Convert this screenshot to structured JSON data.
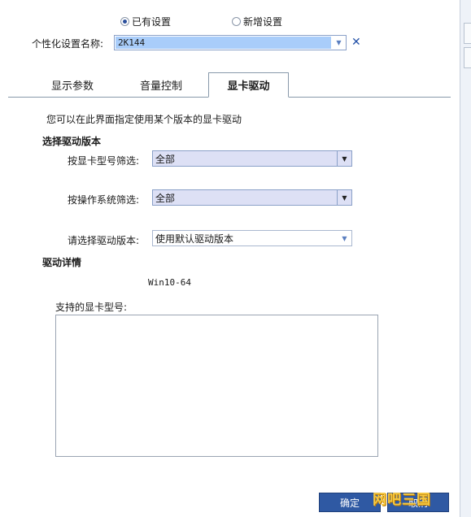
{
  "mode": {
    "existing_label": "已有设置",
    "new_label": "新增设置",
    "selected": "existing"
  },
  "profile": {
    "label": "个性化设置名称:",
    "value": "2K144"
  },
  "tabs": [
    {
      "label": "显示参数",
      "active": false
    },
    {
      "label": "音量控制",
      "active": false
    },
    {
      "label": "显卡驱动",
      "active": true
    }
  ],
  "driver_tab": {
    "description": "您可以在此界面指定使用某个版本的显卡驱动",
    "section_title": "选择驱动版本",
    "gpu_filter": {
      "label": "按显卡型号筛选:",
      "value": "全部"
    },
    "os_filter": {
      "label": "按操作系统筛选:",
      "value": "全部"
    },
    "version_select": {
      "label": "请选择驱动版本:",
      "value": "使用默认驱动版本"
    },
    "details_title": "驱动详情",
    "os_value": "Win10-64",
    "supported_label": "支持的显卡型号:"
  },
  "footer": {
    "ok_label": "确定",
    "cancel_label": "取消"
  },
  "watermark": "网吧三国",
  "colors": {
    "combo_fill": "#dde0f5",
    "combo_selected_fill": "#a9cdfa",
    "button_blue": "#2f59a3",
    "close_icon": "#2452a8"
  }
}
